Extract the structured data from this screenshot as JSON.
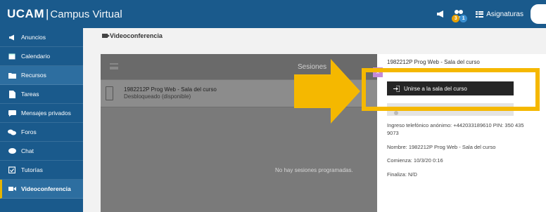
{
  "header": {
    "brand_bold": "UCAM",
    "brand_sep": "|",
    "brand_sub": "Campus Virtual",
    "notif_count_1": "3",
    "notif_count_2": "1",
    "subjects_label": "Asignaturas"
  },
  "sidebar": {
    "items": [
      {
        "label": "Anuncios",
        "icon": "megaphone-icon"
      },
      {
        "label": "Calendario",
        "icon": "calendar-icon"
      },
      {
        "label": "Recursos",
        "icon": "folder-icon"
      },
      {
        "label": "Tareas",
        "icon": "document-icon"
      },
      {
        "label": "Mensajes privados",
        "icon": "chat-icon"
      },
      {
        "label": "Foros",
        "icon": "forum-icon"
      },
      {
        "label": "Chat",
        "icon": "speech-bubble-icon"
      },
      {
        "label": "Tutorías",
        "icon": "calendar-check-icon"
      },
      {
        "label": "Videoconferencia",
        "icon": "video-camera-icon"
      }
    ]
  },
  "main": {
    "section_title": "Videoconferencia",
    "panel_header": "Sesiones",
    "session": {
      "title": "1982212P Prog Web - Sala del curso",
      "status": "Desbloqueado (disponible)"
    },
    "empty_message": "No hay sesiones programadas.",
    "close_label": "×"
  },
  "detail": {
    "name_top": "1982212P Prog Web - Sala del curso",
    "join_label": "Unirse a la sala del curso",
    "phone_info": "Ingreso telefónico anónimo: +442033189610 PIN: 350 435 9073",
    "name_label": "Nombre: 1982212P Prog Web - Sala del curso",
    "start_label": "Comienza: 10/3/20 0:16",
    "end_label": "Finaliza: N/D"
  },
  "colors": {
    "nav_bg": "#1a5a8c",
    "highlight": "#f5b800",
    "active_marker": "#e8b500",
    "close_button": "#c58bd9"
  }
}
